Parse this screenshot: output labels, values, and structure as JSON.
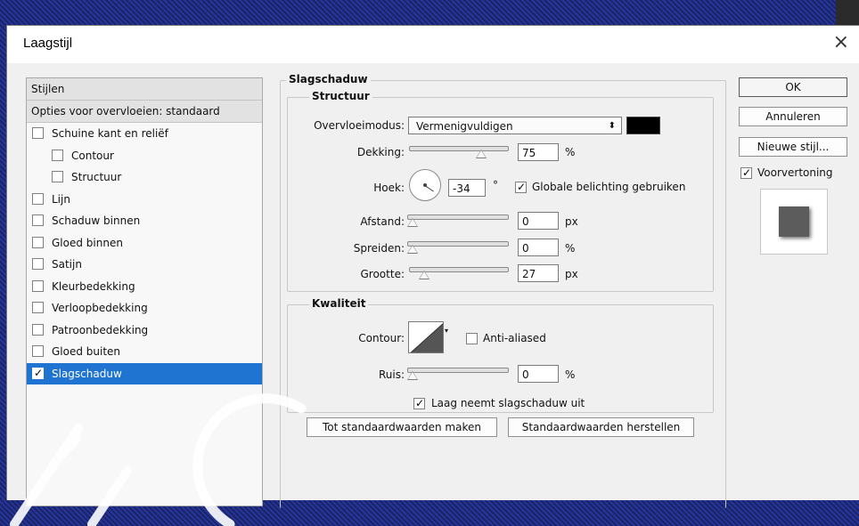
{
  "dialog": {
    "title": "Laagstijl",
    "close_icon": "×"
  },
  "styles_panel": {
    "header": "Stijlen",
    "blend_options": "Opties voor overvloeien: standaard",
    "items": [
      {
        "label": "Schuine kant en reliëf",
        "checked": false
      },
      {
        "label": "Contour",
        "checked": false
      },
      {
        "label": "Structuur",
        "checked": false
      },
      {
        "label": "Lijn",
        "checked": false
      },
      {
        "label": "Schaduw binnen",
        "checked": false
      },
      {
        "label": "Gloed binnen",
        "checked": false
      },
      {
        "label": "Satijn",
        "checked": false
      },
      {
        "label": "Kleurbedekking",
        "checked": false
      },
      {
        "label": "Verloopbedekking",
        "checked": false
      },
      {
        "label": "Patroonbedekking",
        "checked": false
      },
      {
        "label": "Gloed buiten",
        "checked": false
      },
      {
        "label": "Slagschaduw",
        "checked": true
      }
    ]
  },
  "drop_shadow": {
    "section_title": "Slagschaduw",
    "structure_title": "Structuur",
    "blend_mode_label": "Overvloeimodus:",
    "blend_mode_value": "Vermenigvuldigen",
    "shadow_color": "#000000",
    "opacity_label": "Dekking:",
    "opacity_value": "75",
    "opacity_unit": "%",
    "angle_label": "Hoek:",
    "angle_value": "-34",
    "angle_unit": "°",
    "global_light_label": "Globale belichting gebruiken",
    "global_light_checked": true,
    "distance_label": "Afstand:",
    "distance_value": "0",
    "distance_unit": "px",
    "spread_label": "Spreiden:",
    "spread_value": "0",
    "spread_unit": "%",
    "size_label": "Grootte:",
    "size_value": "27",
    "size_unit": "px",
    "quality_title": "Kwaliteit",
    "contour_label": "Contour:",
    "antialias_label": "Anti-aliased",
    "antialias_checked": false,
    "noise_label": "Ruis:",
    "noise_value": "0",
    "noise_unit": "%",
    "knockout_label": "Laag neemt slagschaduw uit",
    "knockout_checked": true,
    "make_default_label": "Tot standaardwaarden maken",
    "reset_default_label": "Standaardwaarden herstellen"
  },
  "actions": {
    "ok_label": "OK",
    "cancel_label": "Annuleren",
    "new_style_label": "Nieuwe stijl...",
    "preview_label": "Voorvertoning",
    "preview_checked": true
  }
}
